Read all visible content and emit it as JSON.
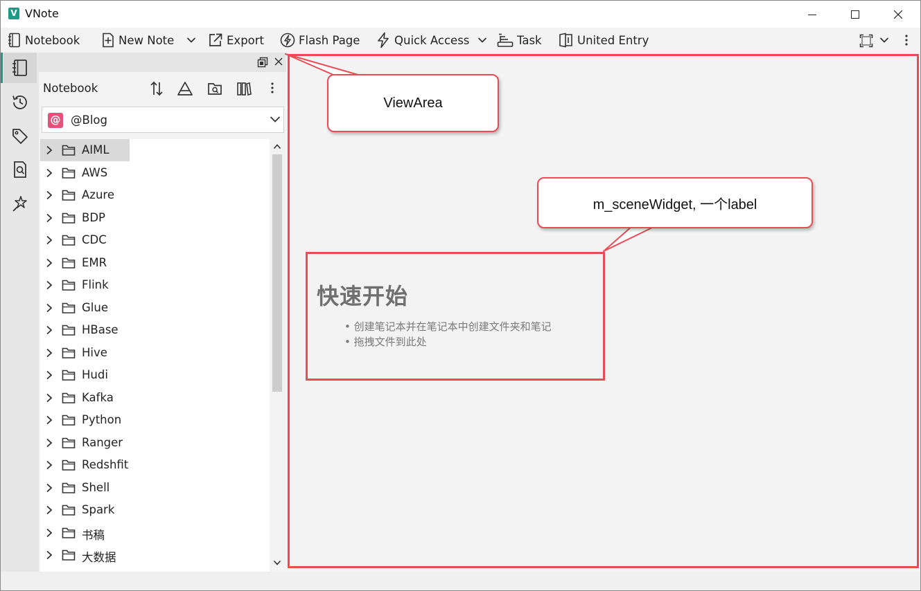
{
  "window": {
    "app_icon_letter": "V",
    "title": "VNote"
  },
  "toolbar": {
    "notebook": "Notebook",
    "new_note": "New Note",
    "export": "Export",
    "flash_page": "Flash Page",
    "quick_access": "Quick Access",
    "task": "Task",
    "united_entry": "United Entry"
  },
  "panel": {
    "title": "Notebook",
    "selected_notebook": "@Blog",
    "notebook_icon_letter": "@",
    "folders": [
      {
        "name": "AIML",
        "selected": true
      },
      {
        "name": "AWS"
      },
      {
        "name": "Azure"
      },
      {
        "name": "BDP"
      },
      {
        "name": "CDC"
      },
      {
        "name": "EMR"
      },
      {
        "name": "Flink"
      },
      {
        "name": "Glue"
      },
      {
        "name": "HBase"
      },
      {
        "name": "Hive"
      },
      {
        "name": "Hudi"
      },
      {
        "name": "Kafka"
      },
      {
        "name": "Python"
      },
      {
        "name": "Ranger"
      },
      {
        "name": "Redshfit"
      },
      {
        "name": "Shell"
      },
      {
        "name": "Spark"
      },
      {
        "name": "书稿"
      },
      {
        "name": "大数据"
      }
    ]
  },
  "dock": {
    "items": [
      "notebook-icon",
      "history-icon",
      "tag-icon",
      "search-icon",
      "snippet-icon"
    ],
    "accent_color": "#1b9b86"
  },
  "scene": {
    "title": "快速开始",
    "items": [
      "创建笔记本并在笔记本中创建文件夹和笔记",
      "拖拽文件到此处"
    ]
  },
  "annotations": {
    "view_area": "ViewArea",
    "scene_widget": "m_sceneWidget, 一个label",
    "highlight_color": "#ea4b55"
  }
}
